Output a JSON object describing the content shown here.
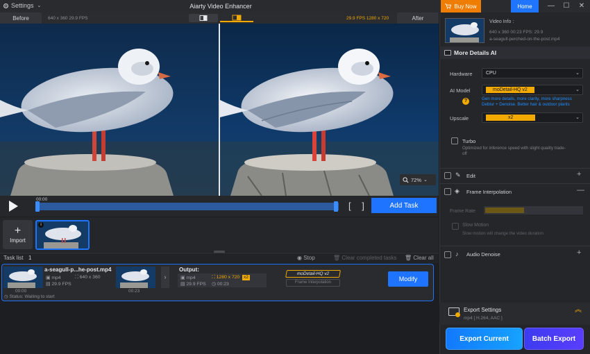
{
  "titlebar": {
    "settings_label": "Settings",
    "app_title": "Aiarty Video Enhancer",
    "buy_now_label": "Buy Now",
    "home_label": "Home",
    "minimize": "—",
    "maximize": "☐",
    "close": "✕"
  },
  "compare": {
    "before_label": "Before",
    "before_info": "640 x 360   29.9 FPS",
    "after_info": "29.9 FPS   1280 x 720",
    "after_label": "After"
  },
  "preview": {
    "zoom_value": "72%"
  },
  "transport": {
    "time": "00:00",
    "progress_fraction": 1.0,
    "crop_brackets": "[ ]",
    "add_task_label": "Add Task"
  },
  "import": {
    "plus": "+",
    "label": "Import"
  },
  "tasklist": {
    "label": "Task list",
    "count": "1",
    "stop_label": "Stop",
    "clear_completed_label": "Clear completed tasks",
    "clear_all_label": "Clear all"
  },
  "task": {
    "file_name": "a-seagull-p...he-post.mp4",
    "input_format": "mp4",
    "input_resolution": "640 x 360",
    "input_fps": "29.9 FPS",
    "thumb_time_start": "00:00",
    "thumb_time_end": "00:23",
    "output_label": "Output:",
    "output_format": "mp4",
    "output_resolution": "1280 x 720",
    "output_scale": "x2",
    "output_fps": "29.9 FPS",
    "output_duration": "00:23",
    "model_chip": "moDetail-HQ  v2",
    "frame_interp_chip": "Frame Interpolation",
    "modify_label": "Modify",
    "status": "Status: Waiting to start"
  },
  "right_panel": {
    "video_info_title": "Video Info :",
    "video_info_meta": "640 x 360   00:23   FPS: 29.9",
    "video_info_file": "a-seagull-perched-on-the-post.mp4",
    "section_title": "More Details AI",
    "hardware_label": "Hardware",
    "hardware_value": "CPU",
    "ai_model_label": "AI Model",
    "ai_model_value": "moDetail-HQ  v2",
    "model_desc_1": "Gen more details, more clarity, more sharpness",
    "model_desc_2": "Deblur + Denoise. Better hair & outdoor plants",
    "upscale_label": "Upscale",
    "upscale_value": "x2",
    "turbo_label": "Turbo",
    "turbo_desc": "Optimized for inference speed with slight quality trade-off",
    "edit_label": "Edit",
    "frame_interp_label": "Frame Interpolation",
    "frame_rate_label": "Frame Rate",
    "slow_motion_label": "Slow Motion",
    "slow_motion_desc": "Slow motion will change the video duration",
    "audio_denoise_label": "Audio Denoise",
    "export_settings_label": "Export Settings",
    "export_settings_sub": "mp4 [ H.264, AAC ]",
    "export_current_label": "Export Current",
    "batch_export_label": "Batch Export"
  },
  "icons": {
    "gear": "gear-icon",
    "cart": "cart-icon",
    "play": "play-icon",
    "magnifier": "zoom-icon",
    "help": "help-icon"
  },
  "colors": {
    "accent_blue": "#1e73ff",
    "accent_orange": "#ef7d00",
    "chip_yellow": "#f2a900"
  }
}
